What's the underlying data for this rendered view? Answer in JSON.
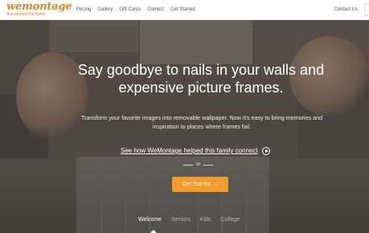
{
  "header": {
    "logo_word": "wemontage",
    "logo_tagline": "live beyond the frame",
    "nav": [
      {
        "label": "Pricing"
      },
      {
        "label": "Gallery"
      },
      {
        "label": "Gift Cards"
      },
      {
        "label": "Contest"
      },
      {
        "label": "Get Started"
      }
    ],
    "contact": "Contact Us"
  },
  "hero": {
    "headline": "Say goodbye to nails in your walls and expensive picture frames.",
    "subline": "Transform your favorite images into removable wallpaper. Now it's easy to bring memories and inspiration to places where frames fail.",
    "video_link": "See how WeMontage helped this family connect",
    "or": "or",
    "cta": "Get Started →"
  },
  "tabs": [
    {
      "label": "Welcome",
      "active": true
    },
    {
      "label": "Seniors",
      "active": false
    },
    {
      "label": "Kids",
      "active": false
    },
    {
      "label": "College",
      "active": false
    }
  ],
  "colors": {
    "brand": "#d9862a",
    "cta": "#f29b2e"
  }
}
